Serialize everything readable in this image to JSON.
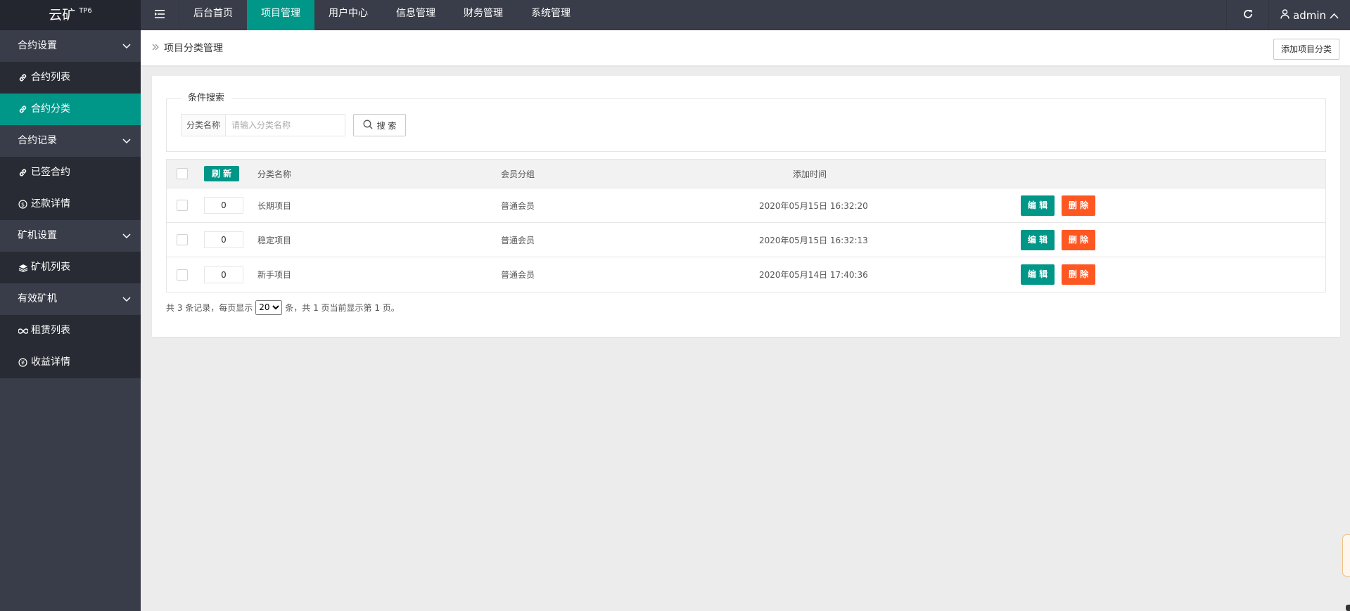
{
  "app": {
    "logo": "云矿",
    "logo_sup": "TP6"
  },
  "topnav": [
    {
      "label": "后台首页",
      "active": false
    },
    {
      "label": "项目管理",
      "active": true
    },
    {
      "label": "用户中心",
      "active": false
    },
    {
      "label": "信息管理",
      "active": false
    },
    {
      "label": "财务管理",
      "active": false
    },
    {
      "label": "系统管理",
      "active": false
    }
  ],
  "user": {
    "name": "admin"
  },
  "sidebar": {
    "group1": "合约设置",
    "item1": "合约列表",
    "item2": "合约分类",
    "group2": "合约记录",
    "item3": "已签合约",
    "item4": "还款详情",
    "group3": "矿机设置",
    "item5": "矿机列表",
    "group4": "有效矿机",
    "item6": "租赁列表",
    "item7": "收益详情"
  },
  "breadcrumb": {
    "title": "项目分类管理"
  },
  "toolbar": {
    "add_label": "添加项目分类"
  },
  "search": {
    "legend": "条件搜索",
    "label": "分类名称",
    "placeholder": "请输入分类名称",
    "button": "搜 索"
  },
  "table": {
    "refresh_label": "刷 新",
    "headers": {
      "name": "分类名称",
      "group": "会员分组",
      "time": "添加时间"
    },
    "rows": [
      {
        "order": "0",
        "name": "长期项目",
        "group": "普通会员",
        "time": "2020年05月15日 16:32:20"
      },
      {
        "order": "0",
        "name": "稳定项目",
        "group": "普通会员",
        "time": "2020年05月15日 16:32:13"
      },
      {
        "order": "0",
        "name": "新手项目",
        "group": "普通会员",
        "time": "2020年05月14日 17:40:36"
      }
    ],
    "edit_label": "编 辑",
    "delete_label": "删 除"
  },
  "pager": {
    "prefix": "共 3 条记录，每页显示",
    "page_size": "20",
    "suffix": "条，共 1 页当前显示第 1 页。"
  },
  "colors": {
    "accent": "#009688",
    "danger": "#ff5722",
    "topbar": "#393d49"
  }
}
